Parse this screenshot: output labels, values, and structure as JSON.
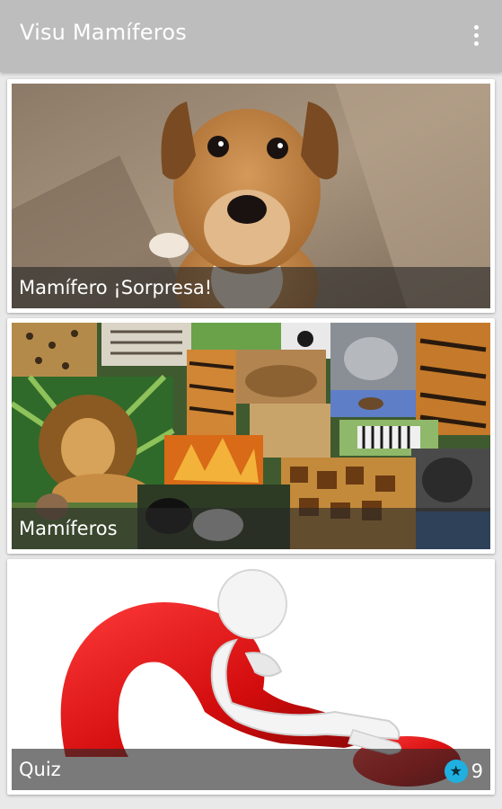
{
  "app": {
    "title": "Visu Mamíferos",
    "menu_icon": "more-vert-icon"
  },
  "cards": [
    {
      "label": "Mamífero ¡Sorpresa!",
      "image": "puppy-photo"
    },
    {
      "label": "Mamíferos",
      "image": "mammals-collage"
    },
    {
      "label": "Quiz",
      "image": "question-mark-figure",
      "score_icon": "star-icon",
      "score": "9"
    }
  ],
  "colors": {
    "appbar": "#bdbdbd",
    "background": "#e9e9e9",
    "caption_overlay": "#282828",
    "badge": "#1fb0e0",
    "question_mark": "#e01010"
  }
}
